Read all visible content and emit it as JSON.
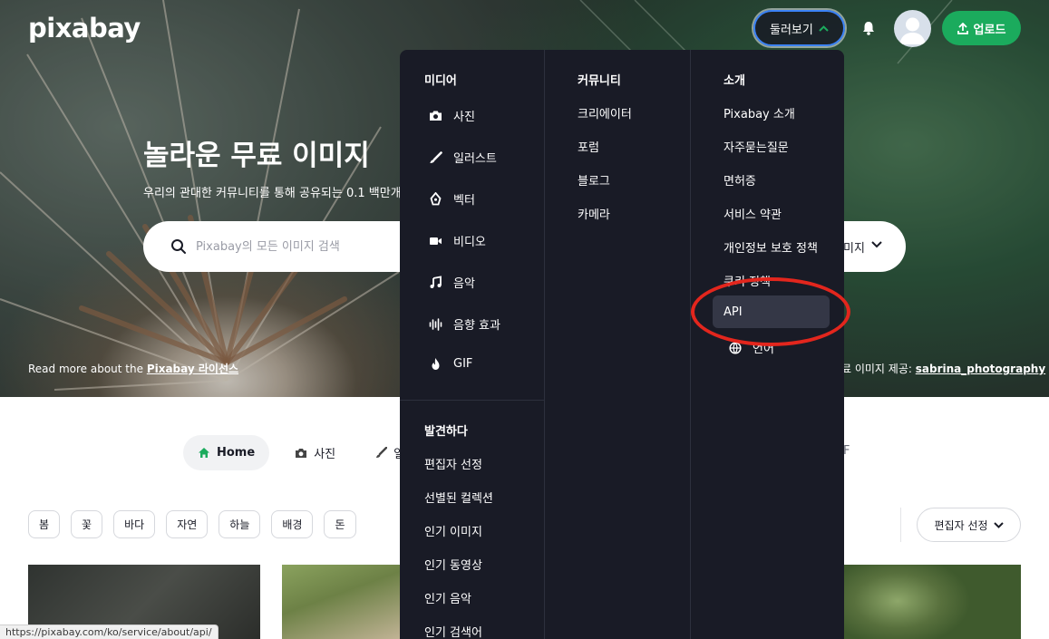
{
  "header": {
    "logo": "pixabay",
    "explore_label": "둘러보기",
    "upload_label": "업로드"
  },
  "hero": {
    "title": "놀라운 무료 이미지",
    "subtitle": "우리의 관대한 커뮤니티를 통해 공유되는 0.1 백만개",
    "search_placeholder": "Pixabay의 모든 이미지 검색",
    "search_type_label": "미지",
    "readmore_prefix": "Read more about the ",
    "readmore_link": "Pixabay 라이선스",
    "credit_prefix": "료 이미지 제공: ",
    "credit_link": "sabrina_photography"
  },
  "menu": {
    "media": {
      "heading": "미디어",
      "items": [
        {
          "label": "사진",
          "icon": "camera-icon"
        },
        {
          "label": "일러스트",
          "icon": "brush-icon"
        },
        {
          "label": "벡터",
          "icon": "pen-nib-icon"
        },
        {
          "label": "비디오",
          "icon": "video-icon"
        },
        {
          "label": "음악",
          "icon": "music-icon"
        },
        {
          "label": "음향 효과",
          "icon": "waveform-icon"
        },
        {
          "label": "GIF",
          "icon": "flame-icon"
        }
      ]
    },
    "discover": {
      "heading": "발견하다",
      "items": [
        "편집자 선정",
        "선별된 컬렉션",
        "인기 이미지",
        "인기 동영상",
        "인기 음악",
        "인기 검색어"
      ]
    },
    "community": {
      "heading": "커뮤니티",
      "items": [
        "크리에이터",
        "포럼",
        "블로그",
        "카메라"
      ]
    },
    "about": {
      "heading": "소개",
      "items": [
        "Pixabay 소개",
        "자주묻는질문",
        "면허증",
        "서비스 약관",
        "개인정보 보호 정책",
        "쿠키 정책",
        "API",
        "언어"
      ]
    }
  },
  "tabs": [
    {
      "label": "Home",
      "icon": "home-icon",
      "active": true
    },
    {
      "label": "사진",
      "icon": "camera-icon",
      "active": false
    },
    {
      "label": "일",
      "icon": "brush-icon",
      "active": false
    }
  ],
  "tabs_right_fragment": "F",
  "chips": [
    "봄",
    "꽃",
    "바다",
    "자연",
    "하늘",
    "배경",
    "돈"
  ],
  "sort_label": "편집자 선정",
  "status_url": "https://pixabay.com/ko/service/about/api/",
  "colors": {
    "brand_green": "#1bab5d",
    "menu_bg": "#191b26",
    "highlight_ring": "#e3261d",
    "focus_blue": "#3b82f6"
  }
}
